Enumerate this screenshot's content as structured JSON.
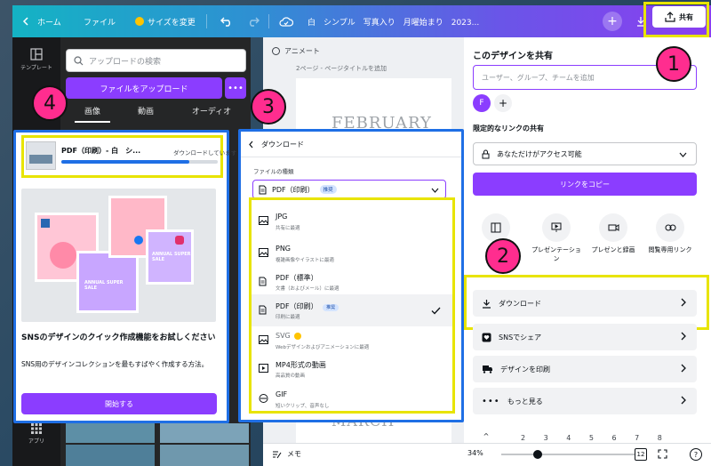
{
  "topbar": {
    "home": "ホーム",
    "file": "ファイル",
    "resize": "サイズを変更",
    "doc_title": "白　シンプル　写真入り　月曜始まり　2023...",
    "share": "共有"
  },
  "rail": {
    "templates": "テンプレート",
    "apps": "アプリ"
  },
  "uploads": {
    "search_placeholder": "アップロードの検索",
    "upload_button": "ファイルをアップロード",
    "more": "•••",
    "tabs": [
      "画像",
      "動画",
      "オーディオ"
    ]
  },
  "download_progress": {
    "title": "PDF（印刷）- 白　シ...",
    "status": "ダウンロードしています",
    "progress_fraction": 0.82
  },
  "promo": {
    "heading": "SNSのデザインのクイック作成機能をお試しください",
    "body": "SNS用のデザインコレクションを最もすばやく作成する方法。",
    "button": "開始する",
    "img_text_1": "ANNUAL SUPER SALE",
    "img_text_2": "ANNUAL SUPER SALE"
  },
  "canvas": {
    "animate": "アニメート",
    "page_label": "2ページ - ページタイトルを追加",
    "month_1": "FEBRUARY",
    "month_2": "MARCH"
  },
  "download_panel": {
    "title": "ダウンロード",
    "file_type_label": "ファイルの種類",
    "selected": "PDF（印刷）",
    "selected_badge": "推奨",
    "options": [
      {
        "title": "JPG",
        "sub": "共有に最適",
        "icon": "image-icon"
      },
      {
        "title": "PNG",
        "sub": "複雑画像やイラストに最適",
        "icon": "image-icon"
      },
      {
        "title": "PDF（標準）",
        "sub": "文書（およびメール）に最適",
        "icon": "document-icon"
      },
      {
        "title": "PDF（印刷）",
        "sub": "印刷に最適",
        "badge": "推奨",
        "icon": "document-icon",
        "selected": true
      },
      {
        "title": "SVG",
        "sub": "Webデザインおよびアニメーションに最適",
        "icon": "image-icon",
        "pro": true
      },
      {
        "title": "MP4形式の動画",
        "sub": "高品質の動画",
        "icon": "video-icon"
      },
      {
        "title": "GIF",
        "sub": "短いクリップ、音声なし",
        "icon": "gif-icon"
      }
    ]
  },
  "share_panel": {
    "title": "このデザインを共有",
    "input_placeholder": "ユーザー、グループ、チームを追加",
    "avatar": "F",
    "link_label": "限定的なリンクの共有",
    "access": "あなただけがアクセス可能",
    "copy_link": "リンクをコピー",
    "actions": [
      "テ",
      "プレゼンテーション",
      "プレゼンと録画",
      "閲覧専用リンク"
    ],
    "rows": [
      "ダウンロード",
      "SNSでシェア",
      "デザインを印刷",
      "もっと見る"
    ]
  },
  "bottombar": {
    "notes": "メモ",
    "zoom": "34%",
    "zoom_level": 0.34,
    "page_count": "12",
    "help": "?"
  },
  "calendar_digits": "2 3 4 5 6 7 8",
  "callouts": [
    "1",
    "2",
    "3",
    "4"
  ],
  "colors": {
    "accent": "#8b3dff",
    "highlight": "#e8e400",
    "frame": "#1f6fe5",
    "badge": "#ff2d8f"
  }
}
